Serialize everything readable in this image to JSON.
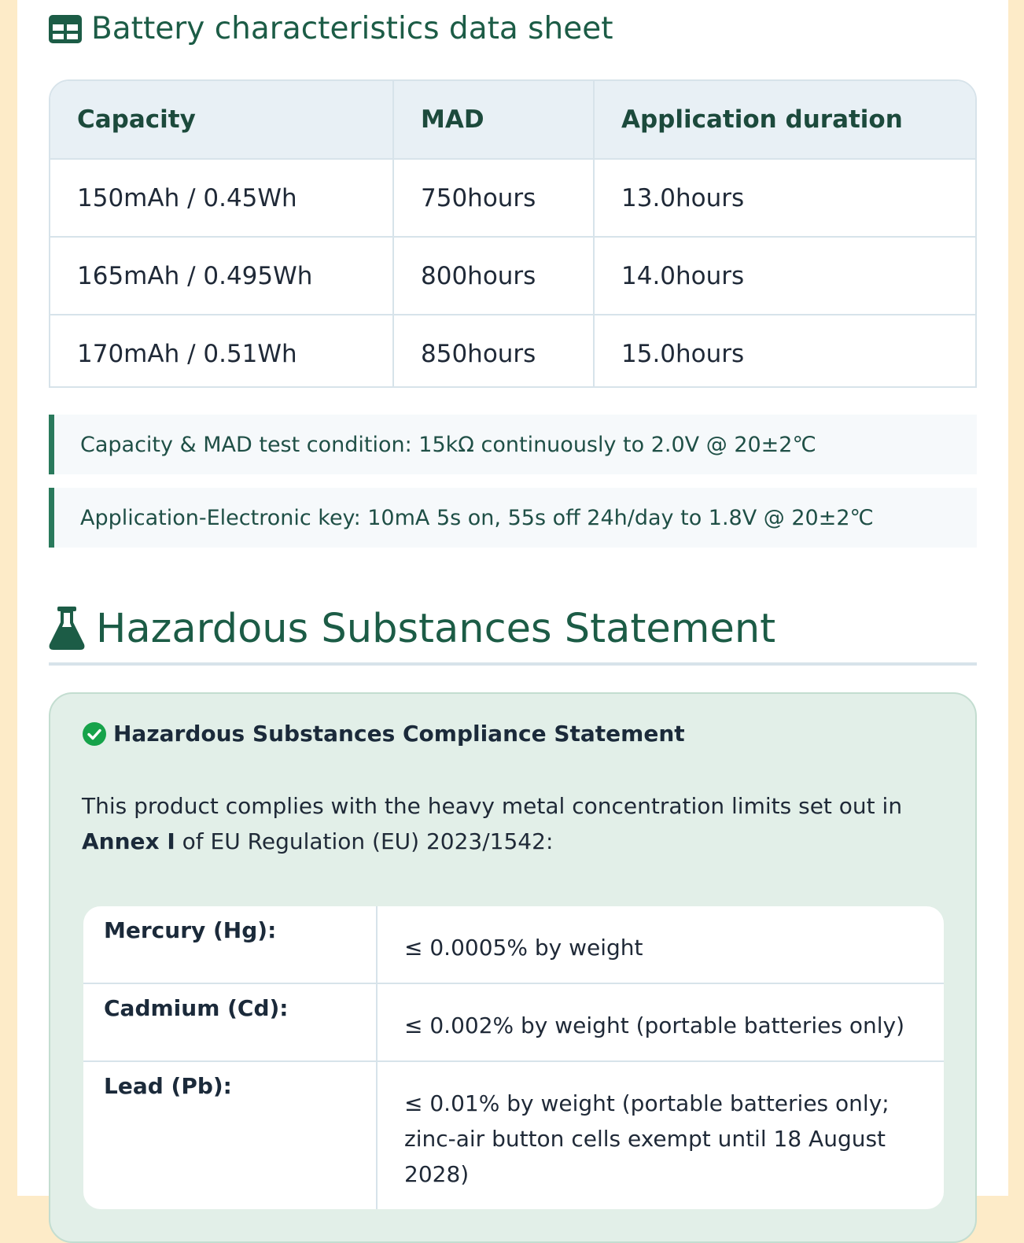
{
  "battery_section": {
    "title": "Battery characteristics data sheet",
    "icon": "table-icon",
    "columns": [
      "Capacity",
      "MAD",
      "Application duration"
    ],
    "rows": [
      [
        "150mAh / 0.45Wh",
        "750hours",
        "13.0hours"
      ],
      [
        "165mAh / 0.495Wh",
        "800hours",
        "14.0hours"
      ],
      [
        "170mAh / 0.51Wh",
        "850hours",
        "15.0hours"
      ]
    ],
    "notes": [
      "Capacity & MAD test condition: 15kΩ continuously to 2.0V @ 20±2℃",
      "Application-Electronic key: 10mA 5s on, 55s off 24h/day to 1.8V @ 20±2℃"
    ]
  },
  "hazard_section": {
    "title": "Hazardous Substances Statement",
    "icon": "flask-icon",
    "card": {
      "title": "Hazardous Substances Compliance Statement",
      "icon": "check-circle-icon",
      "text_before": "This product complies with the heavy metal concentration limits set out in ",
      "text_bold": "Annex I",
      "text_after": " of EU Regulation (EU) 2023/1542:",
      "limits": [
        {
          "substance": "Mercury (Hg):",
          "limit": "≤ 0.0005% by weight"
        },
        {
          "substance": "Cadmium (Cd):",
          "limit": "≤ 0.002% by weight (portable batteries only)"
        },
        {
          "substance": "Lead (Pb):",
          "limit": "≤ 0.01% by weight (portable batteries only; zinc-air button cells exempt until 18 August 2028)"
        }
      ]
    }
  },
  "colors": {
    "heading": "#1c5c46",
    "accent_border": "#2a7a5c",
    "card_bg": "#e2efe8",
    "page_bg": "#fdebc8",
    "check_green": "#16a34a"
  }
}
